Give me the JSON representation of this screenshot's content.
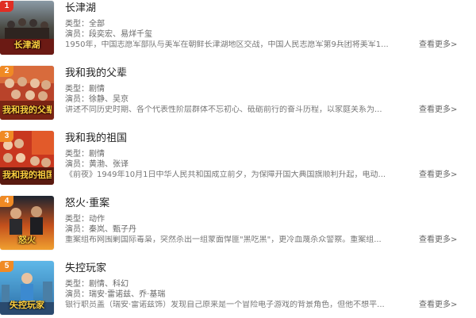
{
  "colors": {
    "rank_top": "#e02e24",
    "rank_other": "#f08a24",
    "title": "#222222",
    "meta": "#666666",
    "description": "#777777"
  },
  "items": [
    {
      "rank": "1",
      "title": "长津湖",
      "type_text": "类型：全部",
      "cast_text": "演员：段奕宏、易烊千玺",
      "description": "1950年，中国志愿军部队与美军在朝鲜长津湖地区交战，中国人民志愿军第9兵团将美军1...",
      "more_label": "查看更多>",
      "poster_text": "长津湖",
      "poster_icon": "poster-war-soldiers"
    },
    {
      "rank": "2",
      "title": "我和我的父辈",
      "type_text": "类型：剧情",
      "cast_text": "演员：徐静、吴京",
      "description": "讲述不同历史时期、各个代表性阶层群体不忘初心、砥砺前行的奋斗历程，以家庭关系为...",
      "more_label": "查看更多>",
      "poster_text": "我和我的父辈",
      "poster_icon": "poster-group-portrait"
    },
    {
      "rank": "3",
      "title": "我和我的祖国",
      "type_text": "类型：剧情",
      "cast_text": "演员：黄渤、张译",
      "description": "《前夜》1949年10月1日中华人民共和国成立前夕，为保障开国大典国旗顺利升起，电动...",
      "more_label": "查看更多>",
      "poster_text": "我和我的祖国",
      "poster_icon": "poster-group-portrait"
    },
    {
      "rank": "4",
      "title": "怒火·重案",
      "type_text": "类型：动作",
      "cast_text": "演员：秦岚、甄子丹",
      "description": "重案组布网围剿国际毒枭，突然杀出一组蒙面悍匪\"黑吃黑\"，更冷血蔑杀众警察。重案组...",
      "more_label": "查看更多>",
      "poster_text": "怒火",
      "poster_icon": "poster-action-fire"
    },
    {
      "rank": "5",
      "title": "失控玩家",
      "type_text": "类型：剧情、科幻",
      "cast_text": "演员：瑞安·雷诺兹、乔·基瑞",
      "description": "银行职员盖（瑞安·雷诺兹饰）发现自己原来是一个冒险电子游戏的背景角色，但他不想平...",
      "more_label": "查看更多>",
      "poster_text": "失控玩家",
      "poster_icon": "poster-city-hero"
    }
  ]
}
